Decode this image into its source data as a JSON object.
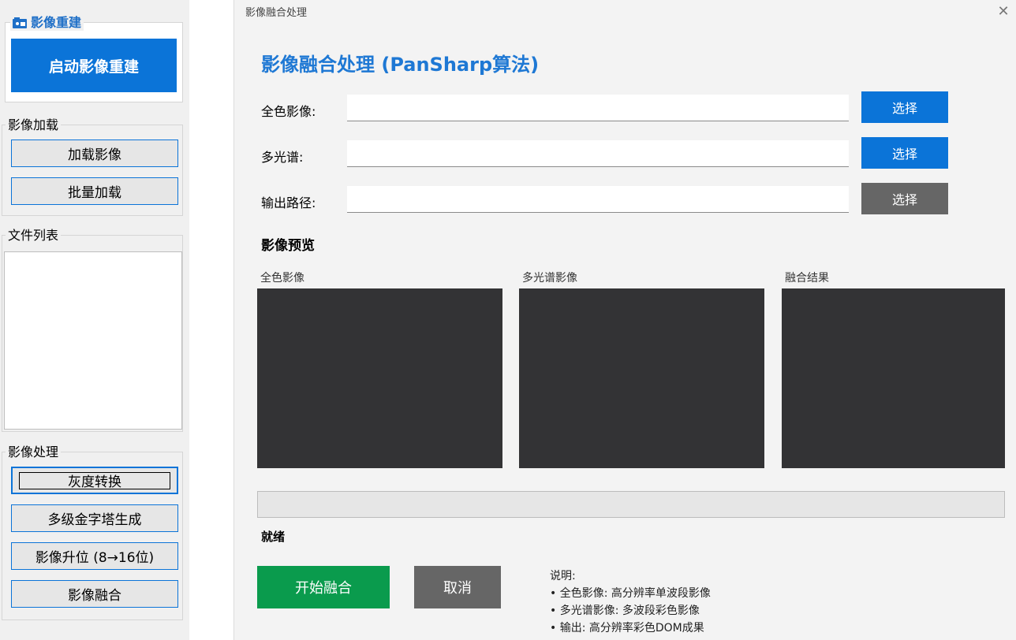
{
  "main_window": {
    "reconstruction_group": {
      "title": "影像重建",
      "button_label": "启动影像重建"
    },
    "load_group": {
      "title": "影像加载",
      "buttons": [
        "加载影像",
        "批量加载"
      ]
    },
    "file_list_group": {
      "title": "文件列表"
    },
    "processing_group": {
      "title": "影像处理",
      "buttons": [
        "灰度转换",
        "多级金字塔生成",
        "影像升位 (8→16位)",
        "影像融合"
      ]
    }
  },
  "dialog": {
    "window_title": "影像融合处理",
    "close_glyph": "✕",
    "heading": "影像融合处理 (PanSharp算法)",
    "fields": [
      {
        "label": "全色影像:",
        "value": "",
        "button": "选择",
        "button_color": "#0b74d8"
      },
      {
        "label": "多光谱:",
        "value": "",
        "button": "选择",
        "button_color": "#0b74d8"
      },
      {
        "label": "输出路径:",
        "value": "",
        "button": "选择",
        "button_color": "#666666"
      }
    ],
    "preview": {
      "title": "影像预览",
      "panels": [
        "全色影像",
        "多光谱影像",
        "融合结果"
      ]
    },
    "progress_fraction": 0,
    "status": "就绪",
    "start_button": "开始融合",
    "cancel_button": "取消",
    "notes": {
      "title": "说明:",
      "lines": [
        "• 全色影像: 高分辨率单波段影像",
        "• 多光谱影像: 多波段彩色影像",
        "• 输出: 高分辨率彩色DOM成果"
      ]
    },
    "colors": {
      "accent": "#1e78d4",
      "start": "#0a9b4d",
      "cancel": "#666666"
    }
  }
}
